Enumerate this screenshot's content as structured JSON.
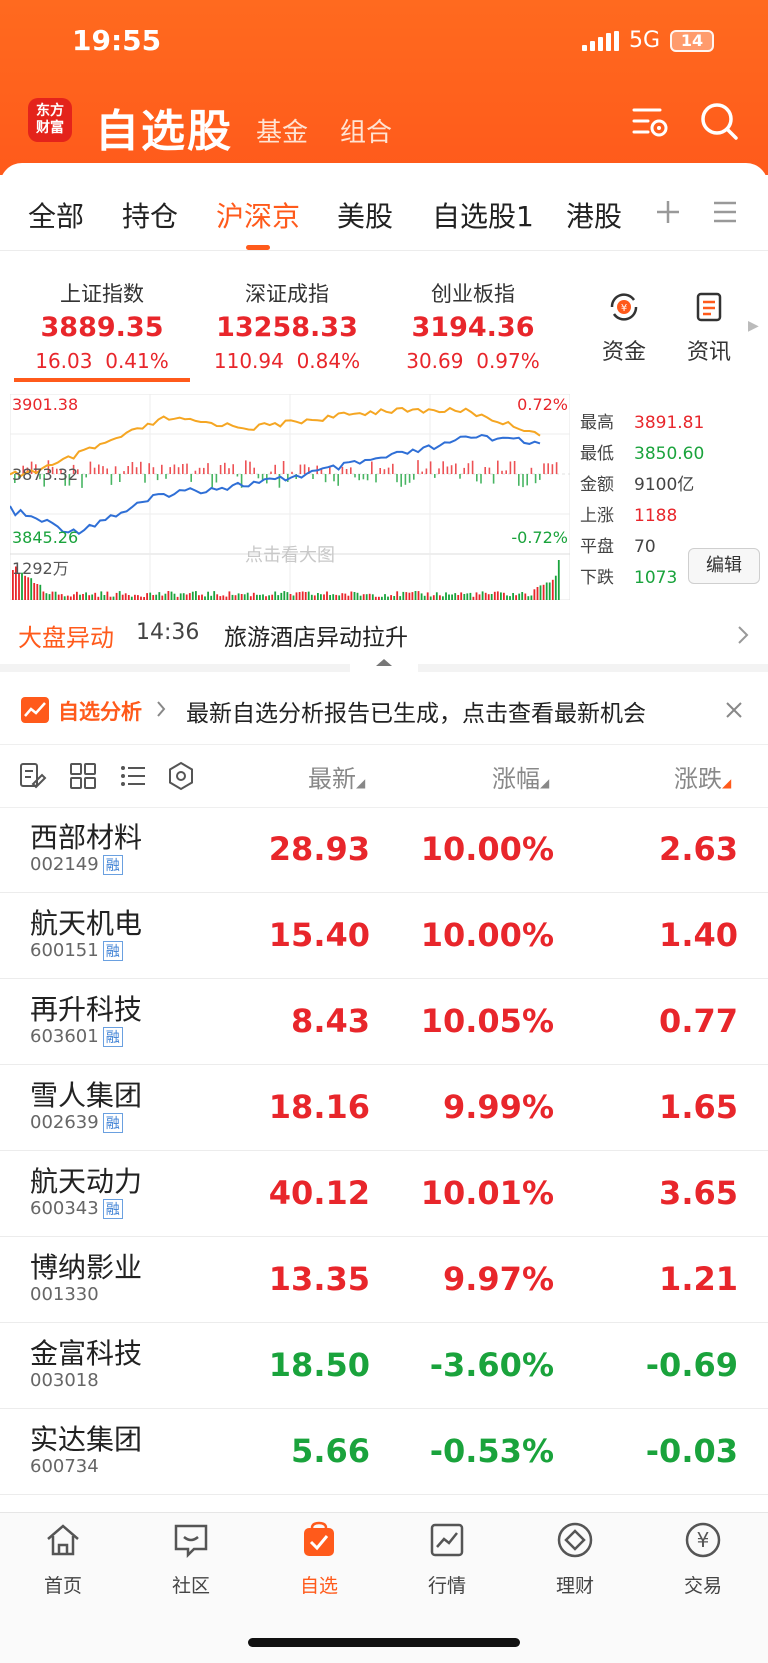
{
  "status_bar": {
    "time": "19:55",
    "network": "5G",
    "battery": "14"
  },
  "header": {
    "logo_line1": "东方",
    "logo_line2": "财富",
    "title": "自选股",
    "tabs": [
      "基金",
      "组合"
    ]
  },
  "category_tabs": [
    "全部",
    "持仓",
    "沪深京",
    "美股",
    "自选股1",
    "港股"
  ],
  "category_active": "沪深京",
  "indices": [
    {
      "name": "上证指数",
      "value": "3889.35",
      "change": "16.03",
      "pct": "0.41%"
    },
    {
      "name": "深证成指",
      "value": "13258.33",
      "change": "110.94",
      "pct": "0.84%"
    },
    {
      "name": "创业板指",
      "value": "3194.36",
      "change": "30.69",
      "pct": "0.97%"
    }
  ],
  "side_buttons": [
    "资金",
    "资讯"
  ],
  "chart": {
    "high_label": "3901.38",
    "mid_label": "3873.32",
    "low_label": "3845.26",
    "pct_top": "0.72%",
    "pct_bottom": "-0.72%",
    "volume_label": "1292万",
    "hint": "点击看大图"
  },
  "stats": [
    {
      "label": "最高",
      "value": "3891.81",
      "color": "#e8262b"
    },
    {
      "label": "最低",
      "value": "3850.60",
      "color": "#1aa33c"
    },
    {
      "label": "金额",
      "value": "9100亿",
      "color": "#444444"
    },
    {
      "label": "上涨",
      "value": "1188",
      "color": "#e8262b"
    },
    {
      "label": "平盘",
      "value": "70",
      "color": "#444444"
    },
    {
      "label": "下跌",
      "value": "1073",
      "color": "#1aa33c"
    }
  ],
  "edit_label": "编辑",
  "market_alert": {
    "label": "大盘异动",
    "time": "14:36",
    "text": "旅游酒店异动拉升"
  },
  "analysis": {
    "label": "自选分析",
    "text": "最新自选分析报告已生成，点击查看最新机会"
  },
  "list_header": {
    "latest": "最新",
    "pct": "涨幅",
    "change": "涨跌"
  },
  "stocks": [
    {
      "name": "西部材料",
      "code": "002149",
      "rong": "融",
      "price": "28.93",
      "pct": "10.00%",
      "change": "2.63",
      "dir": "up"
    },
    {
      "name": "航天机电",
      "code": "600151",
      "rong": "融",
      "price": "15.40",
      "pct": "10.00%",
      "change": "1.40",
      "dir": "up"
    },
    {
      "name": "再升科技",
      "code": "603601",
      "rong": "融",
      "price": "8.43",
      "pct": "10.05%",
      "change": "0.77",
      "dir": "up"
    },
    {
      "name": "雪人集团",
      "code": "002639",
      "rong": "融",
      "price": "18.16",
      "pct": "9.99%",
      "change": "1.65",
      "dir": "up"
    },
    {
      "name": "航天动力",
      "code": "600343",
      "rong": "融",
      "price": "40.12",
      "pct": "10.01%",
      "change": "3.65",
      "dir": "up"
    },
    {
      "name": "博纳影业",
      "code": "001330",
      "rong": "",
      "price": "13.35",
      "pct": "9.97%",
      "change": "1.21",
      "dir": "up"
    },
    {
      "name": "金富科技",
      "code": "003018",
      "rong": "",
      "price": "18.50",
      "pct": "-3.60%",
      "change": "-0.69",
      "dir": "down"
    },
    {
      "name": "实达集团",
      "code": "600734",
      "rong": "",
      "price": "5.66",
      "pct": "-0.53%",
      "change": "-0.03",
      "dir": "down"
    }
  ],
  "bottom_nav": [
    "首页",
    "社区",
    "自选",
    "行情",
    "理财",
    "交易"
  ],
  "bottom_nav_active": "自选",
  "colors": {
    "accent": "#ff5a1b",
    "up": "#e8262b",
    "down": "#1aa33c"
  }
}
